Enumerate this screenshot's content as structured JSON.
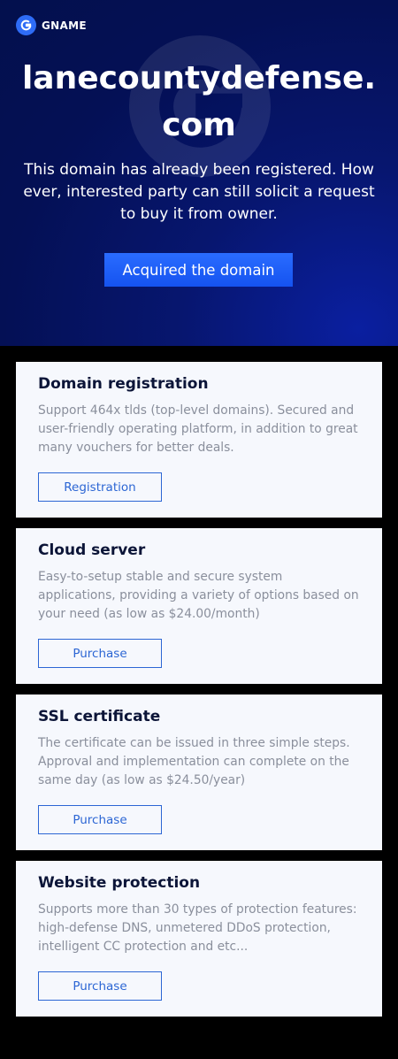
{
  "brand": {
    "name": "GNAME"
  },
  "hero": {
    "domain": "lanecountydefense.com",
    "description": "This domain has already been registered. How ever, interested party can still solicit a request to buy it from owner.",
    "cta_label": "Acquired the domain"
  },
  "cards": [
    {
      "title": "Domain registration",
      "description": "Support 464x tlds (top-level domains). Secured and user-friendly operating platform, in addition to great many vouchers for better deals.",
      "button": "Registration"
    },
    {
      "title": "Cloud server",
      "description": "Easy-to-setup stable and secure system applications, providing a variety of options based on your need (as low as $24.00/month)",
      "button": "Purchase"
    },
    {
      "title": "SSL certificate",
      "description": "The certificate can be issued in three simple steps. Approval and implementation can complete on the same day (as low as $24.50/year)",
      "button": "Purchase"
    },
    {
      "title": "Website protection",
      "description": "Supports more than 30 types of protection features: high-defense DNS, unmetered DDoS protection, intelligent CC protection and etc...",
      "button": "Purchase"
    }
  ]
}
